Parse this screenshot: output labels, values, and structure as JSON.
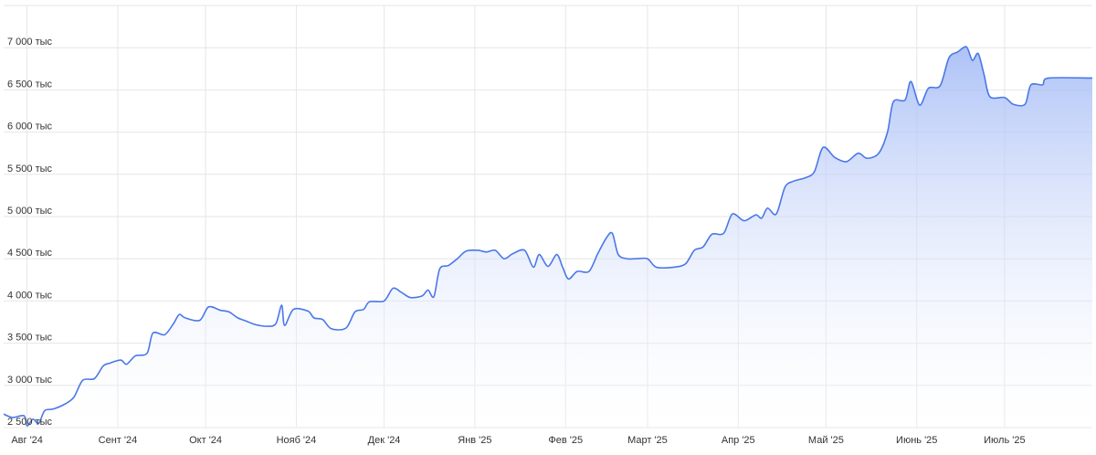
{
  "chart_data": {
    "type": "area",
    "title": "",
    "xlabel": "",
    "ylabel": "",
    "grid": true,
    "legend": "none",
    "colors": {
      "line": "#4a78e8",
      "fill_top": "#9fb7f5",
      "fill_bottom": "#ffffff",
      "grid": "#e6e6e6",
      "text": "#333333"
    },
    "x_range": [
      "2024-07-24",
      "2025-07-31"
    ],
    "y_range": [
      2500000,
      7500000
    ],
    "y_ticks": [
      {
        "value": 2500000,
        "label": "2 500 тыс"
      },
      {
        "value": 3000000,
        "label": "3 000 тыс"
      },
      {
        "value": 3500000,
        "label": "3 500 тыс"
      },
      {
        "value": 4000000,
        "label": "4 000 тыс"
      },
      {
        "value": 4500000,
        "label": "4 500 тыс"
      },
      {
        "value": 5000000,
        "label": "5 000 тыс"
      },
      {
        "value": 5500000,
        "label": "5 500 тыс"
      },
      {
        "value": 6000000,
        "label": "6 000 тыс"
      },
      {
        "value": 6500000,
        "label": "6 500 тыс"
      },
      {
        "value": 7000000,
        "label": "7 000 тыс"
      }
    ],
    "x_ticks": [
      {
        "date": "2024-08-01",
        "label": "Авг '24"
      },
      {
        "date": "2024-09-01",
        "label": "Сент '24"
      },
      {
        "date": "2024-10-01",
        "label": "Окт '24"
      },
      {
        "date": "2024-11-01",
        "label": "Нояб '24"
      },
      {
        "date": "2024-12-01",
        "label": "Дек '24"
      },
      {
        "date": "2025-01-01",
        "label": "Янв '25"
      },
      {
        "date": "2025-02-01",
        "label": "Фев '25"
      },
      {
        "date": "2025-03-01",
        "label": "Март '25"
      },
      {
        "date": "2025-04-01",
        "label": "Апр '25"
      },
      {
        "date": "2025-05-01",
        "label": "Май '25"
      },
      {
        "date": "2025-06-01",
        "label": "Июнь '25"
      },
      {
        "date": "2025-07-01",
        "label": "Июль '25"
      }
    ],
    "series": [
      {
        "points": [
          [
            "2024-07-24",
            2660000
          ],
          [
            "2024-07-27",
            2620000
          ],
          [
            "2024-07-31",
            2640000
          ],
          [
            "2024-08-01",
            2520000
          ],
          [
            "2024-08-03",
            2600000
          ],
          [
            "2024-08-05",
            2550000
          ],
          [
            "2024-08-07",
            2700000
          ],
          [
            "2024-08-10",
            2720000
          ],
          [
            "2024-08-14",
            2780000
          ],
          [
            "2024-08-17",
            2860000
          ],
          [
            "2024-08-20",
            3060000
          ],
          [
            "2024-08-24",
            3080000
          ],
          [
            "2024-08-27",
            3230000
          ],
          [
            "2024-08-29",
            3260000
          ],
          [
            "2024-09-02",
            3300000
          ],
          [
            "2024-09-04",
            3250000
          ],
          [
            "2024-09-07",
            3350000
          ],
          [
            "2024-09-11",
            3380000
          ],
          [
            "2024-09-13",
            3620000
          ],
          [
            "2024-09-17",
            3600000
          ],
          [
            "2024-09-20",
            3730000
          ],
          [
            "2024-09-22",
            3840000
          ],
          [
            "2024-09-24",
            3800000
          ],
          [
            "2024-09-29",
            3770000
          ],
          [
            "2024-10-02",
            3930000
          ],
          [
            "2024-10-06",
            3890000
          ],
          [
            "2024-10-09",
            3870000
          ],
          [
            "2024-10-12",
            3800000
          ],
          [
            "2024-10-15",
            3760000
          ],
          [
            "2024-10-18",
            3720000
          ],
          [
            "2024-10-22",
            3700000
          ],
          [
            "2024-10-25",
            3730000
          ],
          [
            "2024-10-27",
            3950000
          ],
          [
            "2024-10-28",
            3710000
          ],
          [
            "2024-10-31",
            3900000
          ],
          [
            "2024-11-05",
            3880000
          ],
          [
            "2024-11-07",
            3800000
          ],
          [
            "2024-11-10",
            3780000
          ],
          [
            "2024-11-13",
            3670000
          ],
          [
            "2024-11-18",
            3680000
          ],
          [
            "2024-11-21",
            3870000
          ],
          [
            "2024-11-24",
            3900000
          ],
          [
            "2024-11-26",
            3990000
          ],
          [
            "2024-12-01",
            4000000
          ],
          [
            "2024-12-04",
            4150000
          ],
          [
            "2024-12-07",
            4100000
          ],
          [
            "2024-12-10",
            4040000
          ],
          [
            "2024-12-14",
            4060000
          ],
          [
            "2024-12-16",
            4130000
          ],
          [
            "2024-12-18",
            4050000
          ],
          [
            "2024-12-20",
            4380000
          ],
          [
            "2024-12-23",
            4420000
          ],
          [
            "2024-12-26",
            4500000
          ],
          [
            "2024-12-29",
            4590000
          ],
          [
            "2025-01-02",
            4600000
          ],
          [
            "2025-01-05",
            4580000
          ],
          [
            "2025-01-08",
            4600000
          ],
          [
            "2025-01-11",
            4500000
          ],
          [
            "2025-01-14",
            4560000
          ],
          [
            "2025-01-18",
            4600000
          ],
          [
            "2025-01-21",
            4400000
          ],
          [
            "2025-01-23",
            4550000
          ],
          [
            "2025-01-26",
            4410000
          ],
          [
            "2025-01-29",
            4550000
          ],
          [
            "2025-01-31",
            4400000
          ],
          [
            "2025-02-02",
            4260000
          ],
          [
            "2025-02-05",
            4350000
          ],
          [
            "2025-02-09",
            4350000
          ],
          [
            "2025-02-12",
            4560000
          ],
          [
            "2025-02-15",
            4750000
          ],
          [
            "2025-02-17",
            4800000
          ],
          [
            "2025-02-19",
            4550000
          ],
          [
            "2025-02-22",
            4500000
          ],
          [
            "2025-02-25",
            4500000
          ],
          [
            "2025-03-01",
            4500000
          ],
          [
            "2025-03-04",
            4400000
          ],
          [
            "2025-03-10",
            4400000
          ],
          [
            "2025-03-14",
            4440000
          ],
          [
            "2025-03-17",
            4600000
          ],
          [
            "2025-03-20",
            4640000
          ],
          [
            "2025-03-23",
            4790000
          ],
          [
            "2025-03-27",
            4800000
          ],
          [
            "2025-03-30",
            5030000
          ],
          [
            "2025-04-03",
            4950000
          ],
          [
            "2025-04-07",
            5020000
          ],
          [
            "2025-04-09",
            4980000
          ],
          [
            "2025-04-11",
            5100000
          ],
          [
            "2025-04-14",
            5030000
          ],
          [
            "2025-04-17",
            5350000
          ],
          [
            "2025-04-20",
            5420000
          ],
          [
            "2025-04-24",
            5460000
          ],
          [
            "2025-04-27",
            5530000
          ],
          [
            "2025-04-30",
            5820000
          ],
          [
            "2025-05-04",
            5700000
          ],
          [
            "2025-05-08",
            5650000
          ],
          [
            "2025-05-12",
            5750000
          ],
          [
            "2025-05-15",
            5690000
          ],
          [
            "2025-05-19",
            5750000
          ],
          [
            "2025-05-22",
            6000000
          ],
          [
            "2025-05-24",
            6360000
          ],
          [
            "2025-05-28",
            6380000
          ],
          [
            "2025-05-30",
            6600000
          ],
          [
            "2025-06-02",
            6320000
          ],
          [
            "2025-06-05",
            6520000
          ],
          [
            "2025-06-09",
            6550000
          ],
          [
            "2025-06-12",
            6880000
          ],
          [
            "2025-06-15",
            6950000
          ],
          [
            "2025-06-18",
            7010000
          ],
          [
            "2025-06-20",
            6850000
          ],
          [
            "2025-06-22",
            6930000
          ],
          [
            "2025-06-24",
            6680000
          ],
          [
            "2025-06-26",
            6420000
          ],
          [
            "2025-07-01",
            6410000
          ],
          [
            "2025-07-04",
            6330000
          ],
          [
            "2025-07-08",
            6330000
          ],
          [
            "2025-07-10",
            6560000
          ],
          [
            "2025-07-14",
            6560000
          ],
          [
            "2025-07-16",
            6640000
          ]
        ]
      }
    ]
  }
}
